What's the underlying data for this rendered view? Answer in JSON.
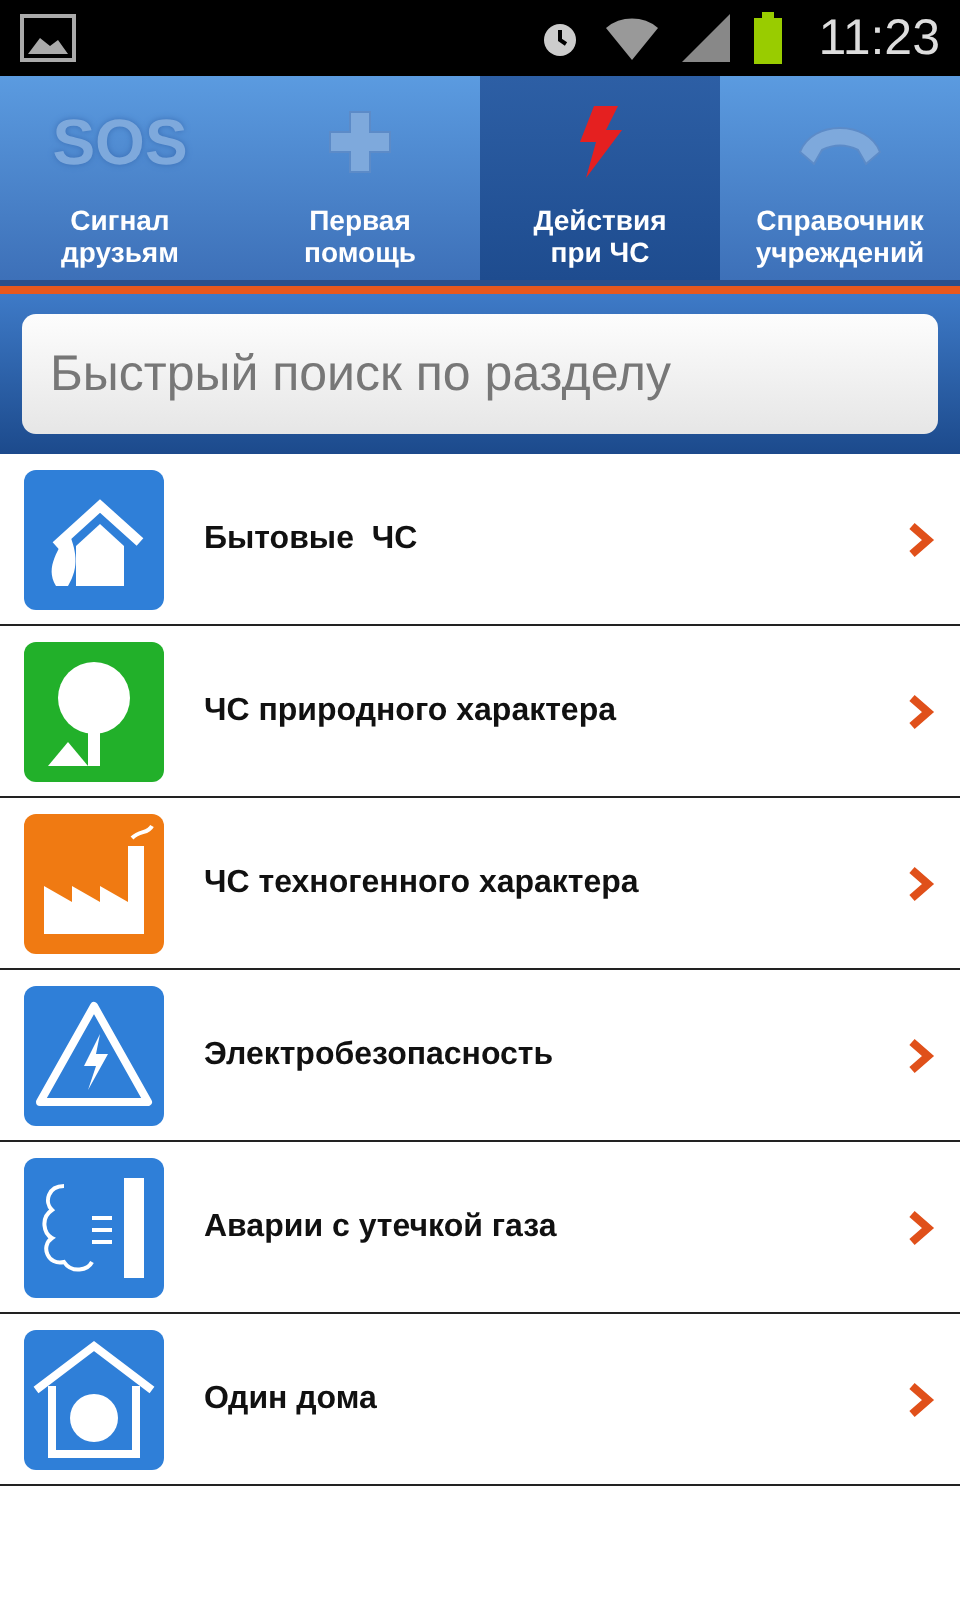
{
  "status_bar": {
    "time": "11:23"
  },
  "tabs": [
    {
      "kind": "sos",
      "icon_text": "SOS",
      "label": "Сигнал\nдрузьям",
      "selected": false
    },
    {
      "kind": "plus",
      "label": "Первая\nпомощь",
      "selected": false
    },
    {
      "kind": "bolt",
      "label": "Действия\nпри ЧС",
      "selected": true
    },
    {
      "kind": "phone",
      "label": "Справочник\nучреждений",
      "selected": false
    }
  ],
  "search": {
    "placeholder": "Быстрый поиск по разделу"
  },
  "items": [
    {
      "kind": "housefire",
      "color": "#2f7fd8",
      "label": "Бытовые  ЧС"
    },
    {
      "kind": "tree",
      "color": "#22b02a",
      "label": "ЧС природного характера"
    },
    {
      "kind": "factory",
      "color": "#f07a12",
      "label": "ЧС техногенного характера"
    },
    {
      "kind": "hazard",
      "color": "#2f7fd8",
      "label": "Электробезопасность"
    },
    {
      "kind": "gas",
      "color": "#2f7fd8",
      "label": "Аварии с утечкой газа"
    },
    {
      "kind": "childhome",
      "color": "#2f7fd8",
      "label": "Один дома"
    }
  ]
}
